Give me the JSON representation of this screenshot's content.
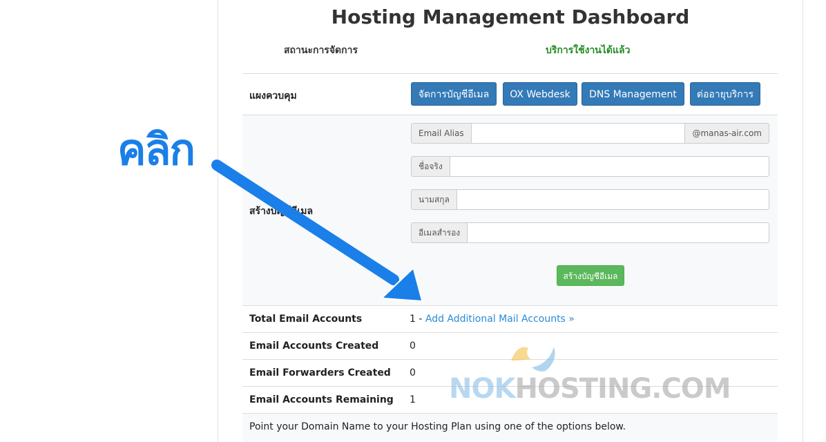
{
  "header": {
    "title": "Hosting Management Dashboard",
    "status_label": "สถานะการจัดการ",
    "status_value": "บริการใช้งานได้แล้ว"
  },
  "control_panel": {
    "label": "แผงควบคุม",
    "buttons": [
      "จัดการบัญชีอีเมล",
      "OX Webdesk",
      "DNS Management",
      "ต่ออายุบริการ"
    ]
  },
  "create_email": {
    "label": "สร้างบัญชีอีเมล",
    "email_alias_label": "Email Alias",
    "email_alias_value": "",
    "domain_suffix": "@manas-air.com",
    "first_name_label": "ชื่อจริง",
    "first_name_value": "",
    "last_name_label": "นามสกุล",
    "last_name_value": "",
    "backup_email_label": "อีเมลสำรอง",
    "backup_email_value": "",
    "submit_label": "สร้างบัญชีอีเมล"
  },
  "stats": {
    "total_label": "Total Email Accounts",
    "total_value": "1 - ",
    "add_link": "Add Additional Mail Accounts »",
    "created_label": "Email Accounts Created",
    "created_value": "0",
    "forwarders_label": "Email Forwarders Created",
    "forwarders_value": "0",
    "remaining_label": "Email Accounts Remaining",
    "remaining_value": "1"
  },
  "footer_note": "Point your Domain Name to your Hosting Plan using one of the options below.",
  "annotation": {
    "click_text": "คลิก",
    "arrow_color": "#1a7fe8"
  },
  "watermark": {
    "part1": "NOK",
    "part2": "HOSTING.COM",
    "color1": "#7fb9e6",
    "color2": "#a0a0a0"
  },
  "colors": {
    "primary": "#337ab7",
    "success": "#5cb85c",
    "status_green": "#228b22",
    "link": "#2a8bd6"
  }
}
